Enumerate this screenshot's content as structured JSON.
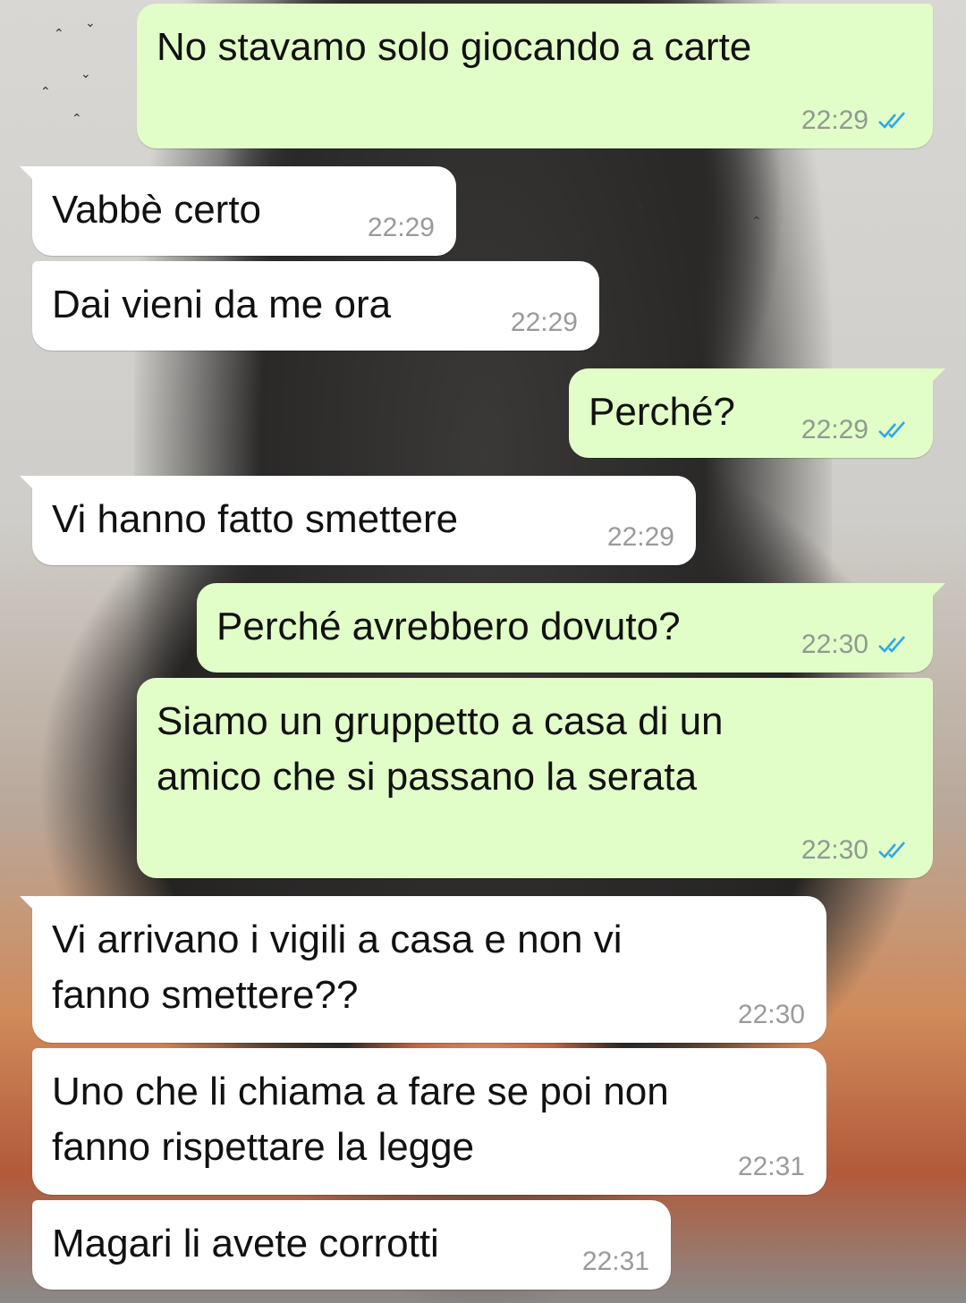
{
  "colors": {
    "outgoing_bubble": "#e2fec8",
    "incoming_bubble": "#ffffff",
    "read_ticks": "#2fa7e6",
    "timestamp": "#8f9a8f"
  },
  "messages": [
    {
      "direction": "out",
      "text": "No stavamo solo giocando a carte",
      "time": "22:29",
      "status_icon": "double-check-read-icon"
    },
    {
      "direction": "in",
      "text": "Vabbè certo",
      "time": "22:29"
    },
    {
      "direction": "in",
      "text": "Dai vieni da me ora",
      "time": "22:29"
    },
    {
      "direction": "out",
      "text": "Perché?",
      "time": "22:29",
      "status_icon": "double-check-read-icon"
    },
    {
      "direction": "in",
      "text": "Vi hanno fatto smettere",
      "time": "22:29"
    },
    {
      "direction": "out",
      "text": "Perché avrebbero dovuto?",
      "time": "22:30",
      "status_icon": "double-check-read-icon"
    },
    {
      "direction": "out",
      "text": "Siamo un gruppetto a casa di un\namico che si passano la serata",
      "time": "22:30",
      "status_icon": "double-check-read-icon"
    },
    {
      "direction": "in",
      "text": "Vi arrivano i vigili a casa e non vi\nfanno smettere??",
      "time": "22:30"
    },
    {
      "direction": "in",
      "text": "Uno che li chiama a fare se poi non\nfanno rispettare la legge",
      "time": "22:31"
    },
    {
      "direction": "in",
      "text": "Magari li avete corrotti",
      "time": "22:31"
    }
  ]
}
